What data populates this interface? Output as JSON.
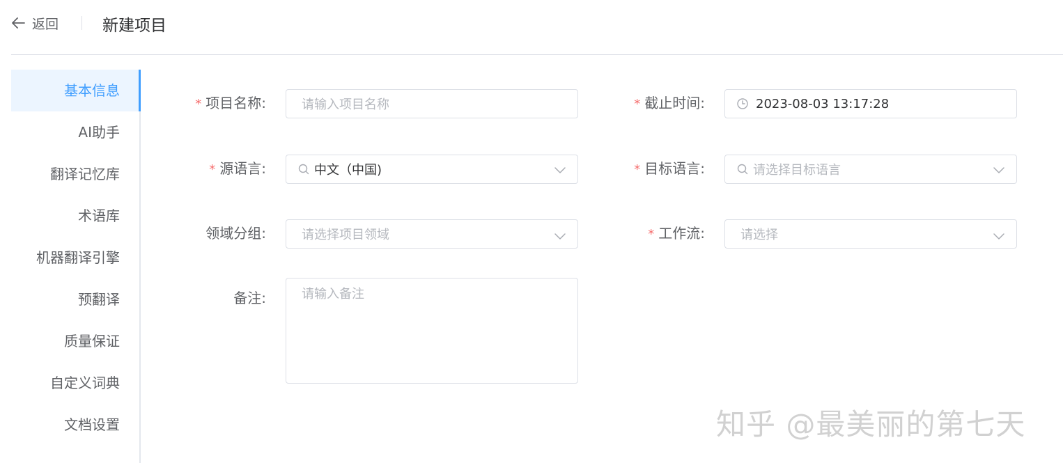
{
  "header": {
    "back_label": "返回",
    "title": "新建项目"
  },
  "sidebar": {
    "items": [
      {
        "label": "基本信息",
        "active": true
      },
      {
        "label": "AI助手"
      },
      {
        "label": "翻译记忆库"
      },
      {
        "label": "术语库"
      },
      {
        "label": "机器翻译引擎"
      },
      {
        "label": "预翻译"
      },
      {
        "label": "质量保证"
      },
      {
        "label": "自定义词典"
      },
      {
        "label": "文档设置"
      }
    ]
  },
  "form": {
    "project_name": {
      "label": "项目名称:",
      "required": true,
      "placeholder": "请输入项目名称"
    },
    "deadline": {
      "label": "截止时间:",
      "required": true,
      "value": "2023-08-03 13:17:28"
    },
    "source_lang": {
      "label": "源语言:",
      "required": true,
      "value": "中文（中国)"
    },
    "target_lang": {
      "label": "目标语言:",
      "required": true,
      "placeholder": "请选择目标语言"
    },
    "domain_group": {
      "label": "领域分组:",
      "required": false,
      "placeholder": "请选择项目领域"
    },
    "workflow": {
      "label": "工作流:",
      "required": true,
      "placeholder": "请选择"
    },
    "notes": {
      "label": "备注:",
      "required": false,
      "placeholder": "请输入备注"
    }
  },
  "watermark": "知乎 @最美丽的第七天",
  "colors": {
    "accent": "#409eff",
    "required": "#f56c6c",
    "border": "#dcdfe6"
  }
}
